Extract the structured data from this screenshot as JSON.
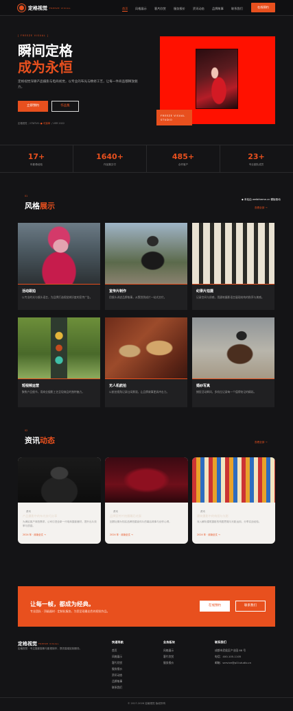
{
  "header": {
    "logo": "定格视觉",
    "logo_sub": "FREEZE VISUAL",
    "nav": [
      "首页",
      "风格展示",
      "客片欣赏",
      "服务报价",
      "资讯动态",
      "品牌故事",
      "联系我们"
    ],
    "active_nav": "首页",
    "cta": "在线预约"
  },
  "hero": {
    "tag": "[ FREEZE VISUAL ]",
    "title_line1": "瞬间定格",
    "title_line2": "成为永恒",
    "desc": "定格视觉深耕产品摄影与电商视觉，以专业的布光与精修工艺，让每一件商品都释放魅力。",
    "btn_primary": "立即预约",
    "btn_secondary": "作品集",
    "meta": [
      "定格视觉",
      "STATUS:",
      "● 可接单",
      "VER 2022"
    ],
    "badge_line1": "FREEZE VISUAL",
    "badge_line2": "STUDIO"
  },
  "stats": [
    {
      "value": "17+",
      "label": "年影像经验"
    },
    {
      "value": "1640+",
      "label": "作品集交付"
    },
    {
      "value": "485+",
      "label": "合作客户"
    },
    {
      "value": "23+",
      "label": "专业团队成员"
    }
  ],
  "styles_section": {
    "index": "01",
    "title_a": "风格",
    "title_b": "展示",
    "more": "查看全部 →",
    "watermark": "◆ 本站由 weibtheme.cn 模板驱动",
    "cards": [
      {
        "title": "活动跟拍",
        "desc": "以专业的光与镜头语言，为品牌打造视觉辨识度的宣传广告。"
      },
      {
        "title": "宣传片制作",
        "desc": "用镜头讲述品牌故事，从策划到成片一站式交付。"
      },
      {
        "title": "纪录片拍摄",
        "desc": "记录空间与质感，用建筑摄影语言展现结构的秩序与美感。"
      },
      {
        "title": "短视频运营",
        "desc": "聚焦产品细节，用商业摄影工艺呈现商品的独特魅力。"
      },
      {
        "title": "无人机航拍",
        "desc": "以航拍视角记录壮阔景观，让品牌故事更具冲击力。"
      },
      {
        "title": "婚纱写真",
        "desc": "捕捉活动瞬间，多机位记录每一个值得铭记的精彩。"
      }
    ]
  },
  "news_section": {
    "index": "02",
    "title_a": "资讯",
    "title_b": "动态",
    "more": "查看全部 →",
    "cards": [
      {
        "tag": "资讯",
        "title": "产品摄影中的布光技巧分享",
        "desc": "为满足客户商拍需求，公司引进全新一代电商摄影器材，提升出片效率与质感。",
        "date": "2024 年 · 阅读全文 →"
      },
      {
        "tag": "资讯",
        "title": "品牌宣传片拍摄幕后花絮",
        "desc": "回顾近期为知名品牌拍摄宣传片的幕后故事与创作心得。",
        "date": "2024 年 · 阅读全文 →"
      },
      {
        "tag": "资讯",
        "title": "建筑摄影中的构图与光影",
        "desc": "深入解析建筑摄影的构图思路与光影运用，分享实战经验。",
        "date": "2024 年 · 阅读全文 →"
      }
    ]
  },
  "cta_band": {
    "title": "让每一帧，都成为经典。",
    "sub": "专业团队 · 顶级器材 · 定制化服务，为您呈现最出色的视觉作品。",
    "btn_primary": "在线预约",
    "btn_secondary": "联系我们"
  },
  "footer": {
    "logo": "定格视觉",
    "logo_sub": "FREEZE VISUAL",
    "desc": "定格视觉 · 专注摄影摄像与影视制作，提供高端定制服务。",
    "col1_title": "快速导航",
    "col1_links": [
      "首页",
      "风格展示",
      "客片欣赏",
      "服务报价",
      "资讯动态",
      "品牌故事",
      "联系我们"
    ],
    "col2_title": "业务板块",
    "col2_links": [
      "风格展示",
      "客片欣赏",
      "服务报价"
    ],
    "col3_title": "联系我们",
    "col3_lines": [
      "成都市武侯区产业园 88 号",
      "电话：400-105-1105",
      "邮箱：service@p0l.studio.cn"
    ],
    "copyright": "© 2017-2026 定格视觉 版权所有"
  },
  "colors": {
    "accent": "#e8501e",
    "background": "#141416",
    "card": "#202022"
  }
}
